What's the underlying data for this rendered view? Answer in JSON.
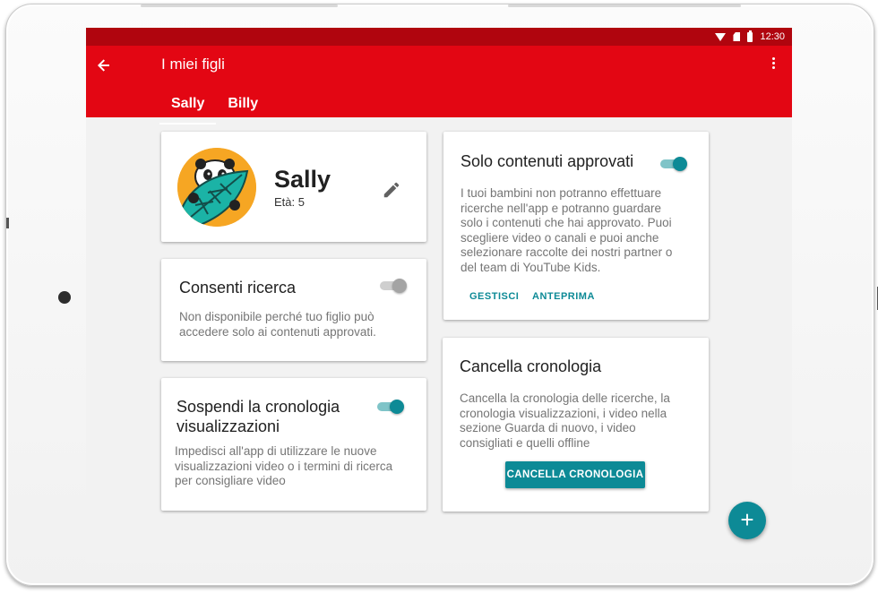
{
  "status_bar": {
    "time": "12:30",
    "icons": [
      "wifi-icon",
      "sim-icon",
      "battery-icon"
    ]
  },
  "app_bar": {
    "title": "I miei figli",
    "back_icon": "arrow-back-icon",
    "menu_icon": "more-vert-icon",
    "tabs": [
      {
        "label": "Sally",
        "active": true
      },
      {
        "label": "Billy",
        "active": false
      }
    ],
    "color": "#e30613"
  },
  "profile": {
    "name": "Sally",
    "age": "Età: 5",
    "edit_icon": "pencil-icon"
  },
  "allow_search": {
    "title": "Consenti ricerca",
    "enabled": false,
    "description": "Non disponibile perché tuo figlio può accedere solo ai contenuti approvati."
  },
  "pause_history": {
    "title_line1": "Sospendi la cronologia",
    "title_line2": "visualizzazioni",
    "enabled": true,
    "description_line1": "Impedisci all'app di utilizzare le nuove",
    "description_line2": "visualizzazioni video o i termini di ricerca",
    "description_line3": "per consigliare video"
  },
  "approved_only": {
    "title": "Solo contenuti approvati",
    "enabled": true,
    "description": [
      "I tuoi bambini non potranno effettuare",
      "ricerche nell'app e potranno guardare",
      "solo i contenuti che hai approvato. Puoi",
      "scegliere video o canali e puoi anche",
      "selezionare raccolte dei nostri partner o",
      "del team di YouTube Kids."
    ],
    "manage_label": "GESTISCI",
    "preview_label": "ANTEPRIMA"
  },
  "clear_history": {
    "title": "Cancella cronologia",
    "description": [
      "Cancella la cronologia delle ricerche, la",
      "cronologia visualizzazioni, i video nella",
      "sezione Guarda di nuovo, i video",
      "consigliati e quelli offline"
    ],
    "button_label": "CANCELLA CRONOLOGIA"
  },
  "fab": {
    "label": "+",
    "icon": "add-icon"
  },
  "colors": {
    "accent": "#0d8a96",
    "status_bar": "#b0050e"
  }
}
